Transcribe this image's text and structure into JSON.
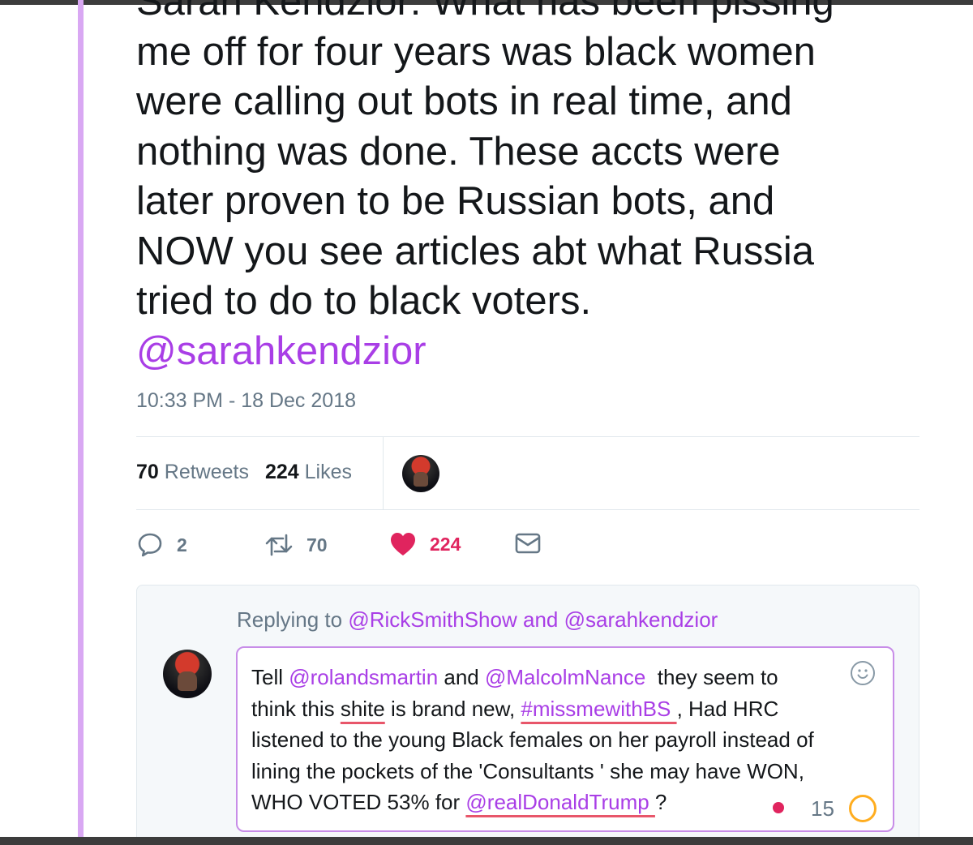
{
  "tweet": {
    "lines": [
      "Sarah Kendzior: What has been pissing",
      "me off for four years was black women",
      "were calling out bots in real time, and",
      "nothing was done. These accts were",
      "later proven to be Russian bots, and",
      "NOW you see articles abt what Russia",
      "tried to do to black voters."
    ],
    "mention": "@sarahkendzior",
    "timestamp": "10:33 PM - 18 Dec 2018"
  },
  "stats": {
    "retweets_count": "70",
    "retweets_label": "Retweets",
    "likes_count": "224",
    "likes_label": "Likes"
  },
  "actions": {
    "reply_count": "2",
    "retweet_count": "70",
    "like_count": "224"
  },
  "reply": {
    "replying_prefix": "Replying to",
    "replying_user1": "@RickSmithShow",
    "replying_and": "and",
    "replying_user2": "@sarahkendzior",
    "line1": {
      "t1": "Tell ",
      "m1": "@rolandsmartin",
      "t2": " and ",
      "m2": "@MalcolmNance",
      "t3": "  they seem to"
    },
    "line2": {
      "t1": "think this ",
      "u1": "shite",
      "t2": " is brand new, ",
      "h1": "#missmewithBS ",
      "t3": ", Had HRC"
    },
    "line3": "listened to the young Black females on her payroll instead of",
    "line4": "lining the pockets of the 'Consultants ' she may have WON,",
    "line5": {
      "t1": "WHO VOTED 53% for ",
      "m1": "@realDonaldTrump ",
      "t2": "?"
    },
    "char_remaining": "15"
  },
  "colors": {
    "accent": "#a93ee6",
    "like": "#e0245e",
    "rail": "#d9a8f3",
    "counter_ring": "#ffad1f"
  }
}
